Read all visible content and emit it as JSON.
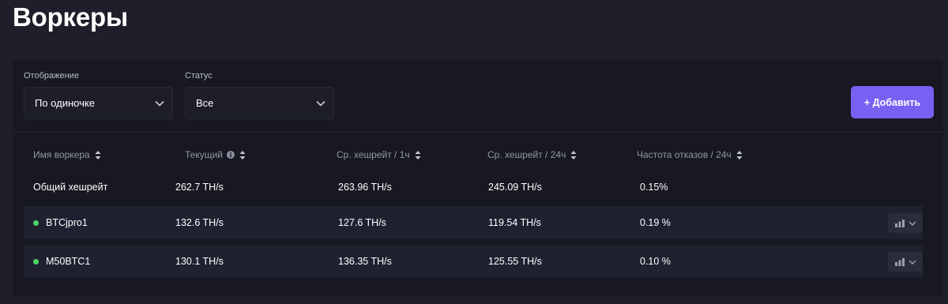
{
  "page": {
    "title": "Воркеры"
  },
  "filters": {
    "display": {
      "label": "Отображение",
      "value": "По одиночке"
    },
    "status": {
      "label": "Статус",
      "value": "Все"
    }
  },
  "add_button": {
    "label": "+ Добавить"
  },
  "table": {
    "columns": [
      {
        "label": "Имя воркера",
        "info": false
      },
      {
        "label": "Текущий",
        "info": true
      },
      {
        "label": "Ср. хешрейт / 1ч",
        "info": false
      },
      {
        "label": "Ср. хешрейт / 24ч",
        "info": false
      },
      {
        "label": "Частота отказов / 24ч",
        "info": false
      }
    ],
    "total": {
      "name": "Общий хешрейт",
      "current": "262.7 TH/s",
      "avg_1h": "263.96 TH/s",
      "avg_24h": "245.09 TH/s",
      "reject": "0.15%"
    },
    "workers": [
      {
        "name": "BTCjpro1",
        "status": "online",
        "current": "132.6 TH/s",
        "avg_1h": "127.6 TH/s",
        "avg_24h": "119.54 TH/s",
        "reject": "0.19 %"
      },
      {
        "name": "M50BTC1",
        "status": "online",
        "current": "130.1 TH/s",
        "avg_1h": "136.35 TH/s",
        "avg_24h": "125.55 TH/s",
        "reject": "0.10 %"
      }
    ]
  },
  "colors": {
    "accent": "#7760f2",
    "online": "#4dd365",
    "background": "#1f1f2b",
    "panel": "#171821"
  }
}
